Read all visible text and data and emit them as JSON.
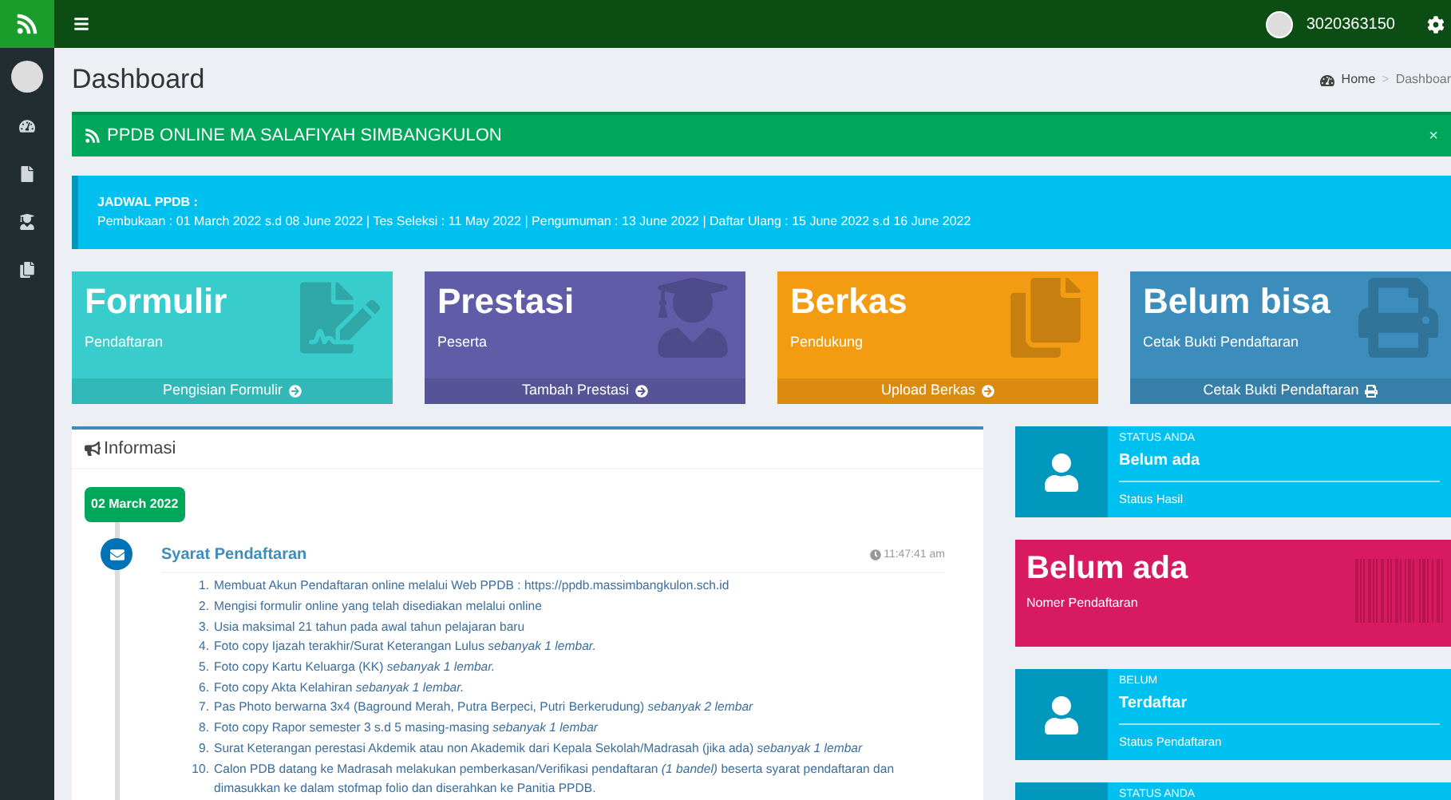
{
  "topbar": {
    "user": "3020363150"
  },
  "page": {
    "title": "Dashboard",
    "breadcrumb": [
      "Home",
      "Dashboar"
    ],
    "separator": ">"
  },
  "alert": {
    "text": "PPDB ONLINE MA SALAFIYAH SIMBANGKULON",
    "close": "×"
  },
  "callout": {
    "title": "JADWAL PPDB :",
    "text": "Pembukaan : 01 March 2022 s.d 08 June 2022 | Tes Seleksi : 11 May 2022 | Pengumuman : 13 June 2022 | Daftar Ulang : 15 June 2022 s.d 16 June 2022"
  },
  "tiles": [
    {
      "title": "Formulir",
      "subtitle": "Pendaftaran",
      "footer": "Pengisian Formulir",
      "color": "#39cccc"
    },
    {
      "title": "Prestasi",
      "subtitle": "Peserta",
      "footer": "Tambah Prestasi",
      "color": "#605ca8"
    },
    {
      "title": "Berkas",
      "subtitle": "Pendukung",
      "footer": "Upload Berkas",
      "color": "#f39c12"
    },
    {
      "title": "Belum bisa",
      "subtitle": "Cetak Bukti Pendaftaran",
      "footer": "Cetak Bukti Pendaftaran",
      "color": "#3c8dbc"
    }
  ],
  "info": {
    "title": "Informasi",
    "date": "02 March 2022",
    "item": {
      "title": "Syarat Pendaftaran",
      "time": "11:47:41 am",
      "requirements": [
        {
          "number": "1.",
          "text": "Membuat Akun Pendaftaran online melalui Web PPDB : https://ppdb.massimbangkulon.sch.id"
        },
        {
          "number": "2.",
          "text": "Mengisi formulir online yang telah disediakan melalui online"
        },
        {
          "number": "3.",
          "text": "Usia maksimal 21 tahun pada awal tahun pelajaran baru"
        },
        {
          "number": "4.",
          "text": "Foto copy Ijazah terakhir/Surat Keterangan Lulus *sebanyak 1 lembar.*"
        },
        {
          "number": "5.",
          "text": "Foto copy Kartu Keluarga (KK) *sebanyak 1 lembar.*"
        },
        {
          "number": "6.",
          "text": "Foto copy Akta Kelahiran *sebanyak 1 lembar.*"
        },
        {
          "number": "7.",
          "text": "Pas Photo berwarna 3x4 (Baground Merah, Putra Berpeci, Putri Berkerudung) *sebanyak 2 lembar*"
        },
        {
          "number": "8.",
          "text": "Foto copy Rapor semester 3 s.d 5 masing-masing *sebanyak 1 lembar*"
        },
        {
          "number": "9.",
          "text": "Surat Keterangan perestasi Akdemik atau non Akademik dari Kepala Sekolah/Madrasah (jika ada) *sebanyak 1 lembar*"
        },
        {
          "number": "10.",
          "text": "Calon PDB datang ke Madrasah melakukan pemberkasan/Verifikasi pendaftaran *(1 bandel)* beserta syarat pendaftaran dan dimasukkan ke dalam stofmap folio dan diserahkan ke Panitia PPDB."
        }
      ]
    }
  },
  "status_cards": [
    {
      "kind": "user",
      "label": "STATUS ANDA",
      "value": "Belum ada",
      "footer": "Status Hasil"
    },
    {
      "kind": "big",
      "value": "Belum ada",
      "footer": "Nomer Pendaftaran"
    },
    {
      "kind": "user",
      "label": "BELUM",
      "value": "Terdaftar",
      "footer": "Status Pendaftaran"
    },
    {
      "kind": "user",
      "label": "STATUS ANDA"
    }
  ]
}
